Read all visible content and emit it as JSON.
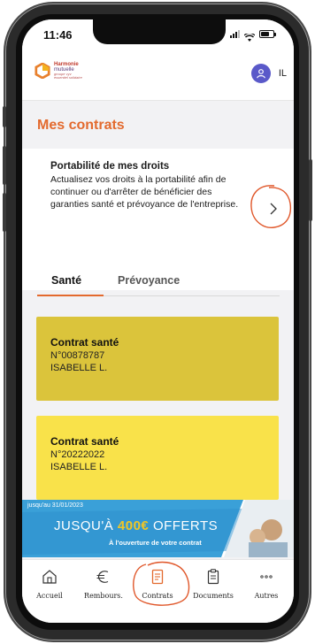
{
  "status_bar": {
    "time": "11:46"
  },
  "header": {
    "logo": {
      "line1": "Harmonie",
      "line2": "mutuelle",
      "line3": "groupe vyv",
      "tagline": "essentiel solidaire"
    },
    "user_initials": "IL",
    "avatar_icon": "user-icon"
  },
  "page": {
    "title": "Mes contrats"
  },
  "portability": {
    "title": "Portabilité de mes droits",
    "description": "Actualisez vos droits à la portabilité afin de continuer ou d'arrêter de bénéficier des garanties santé et prévoyance de l'entreprise.",
    "action_icon": "chevron-right-icon"
  },
  "tabs": [
    {
      "label": "Santé",
      "active": true
    },
    {
      "label": "Prévoyance",
      "active": false
    }
  ],
  "contracts": [
    {
      "title": "Contrat santé",
      "number": "N°00878787",
      "holder": "ISABELLE L.",
      "color": "#dbc43b"
    },
    {
      "title": "Contrat santé",
      "number": "N°20222022",
      "holder": "ISABELLE L.",
      "color": "#f9e24a"
    }
  ],
  "banner": {
    "date": "jusqu'au 31/01/2023",
    "headline_prefix": "JUSQU'À",
    "amount": "400€",
    "headline_suffix": "OFFERTS",
    "subline": "À l'ouverture de votre contrat",
    "color": "#3aa0d8"
  },
  "bottom_nav": [
    {
      "label": "Accueil",
      "icon": "home-icon",
      "active": false
    },
    {
      "label": "Rembours.",
      "icon": "euro-icon",
      "active": false
    },
    {
      "label": "Contrats",
      "icon": "contract-icon",
      "active": true
    },
    {
      "label": "Documents",
      "icon": "documents-icon",
      "active": false
    },
    {
      "label": "Autres",
      "icon": "more-icon",
      "active": false
    }
  ],
  "colors": {
    "accent": "#e36a2e",
    "annotation": "#e0572a",
    "avatar": "#5a59c9"
  }
}
